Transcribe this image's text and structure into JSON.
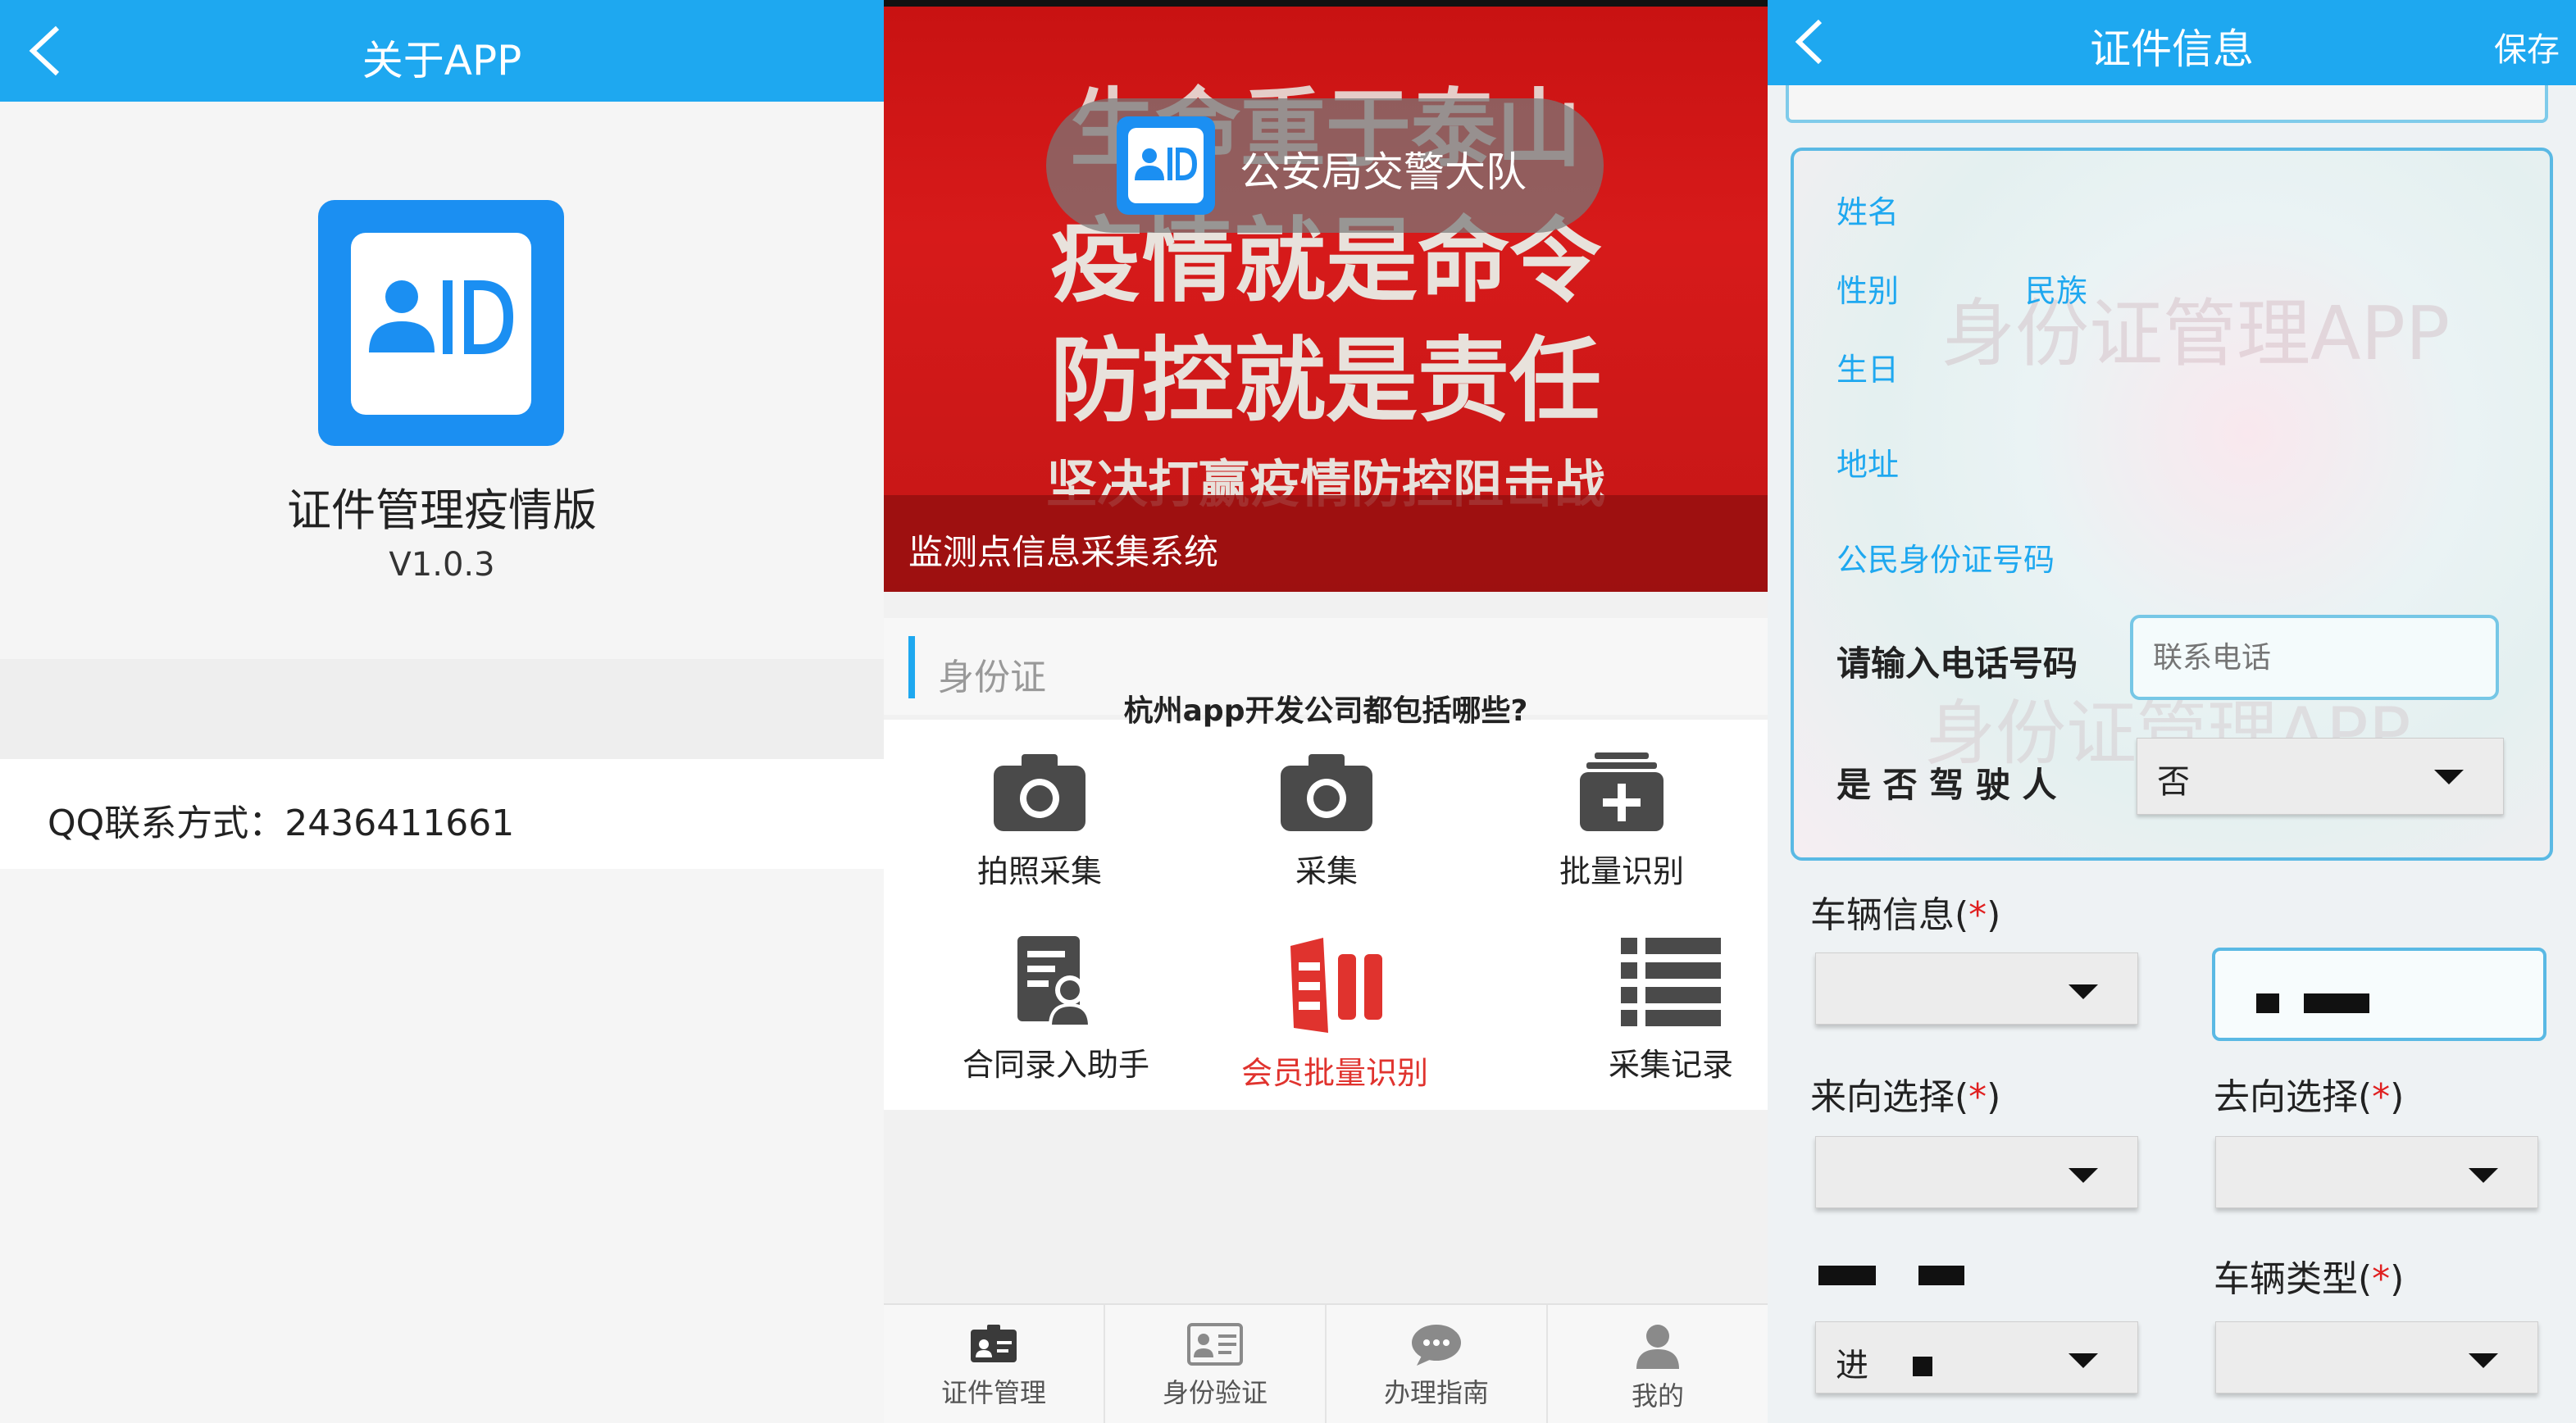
{
  "about_panel": {
    "title": "关于APP",
    "app_name": "证件管理疫情版",
    "version": "V1.0.3",
    "qq_contact": "QQ联系方式：2436411661"
  },
  "home_panel": {
    "banner_slogans": [
      "生命重于泰山",
      "疫情就是命令",
      "防控就是责任",
      "坚决打赢疫情防控阻击战"
    ],
    "org_name": "公安局交警大队",
    "banner_caption": "监测点信息采集系统",
    "section_label": "身份证",
    "overlay_question": "杭州app开发公司都包括哪些?",
    "grid": [
      {
        "label": "拍照采集",
        "icon": "camera-icon"
      },
      {
        "label": "采集",
        "icon": "camera-icon"
      },
      {
        "label": "批量识别",
        "icon": "batch-add-icon"
      },
      {
        "label": "合同录入助手",
        "icon": "contract-user-icon"
      },
      {
        "label": "会员批量识别",
        "icon": "member-batch-icon",
        "color": "#e0332e"
      },
      {
        "label": "采集记录",
        "icon": "list-icon"
      }
    ],
    "tabs": [
      {
        "label": "证件管理",
        "icon": "id-card-icon"
      },
      {
        "label": "身份验证",
        "icon": "id-verify-icon"
      },
      {
        "label": "办理指南",
        "icon": "chat-bubble-icon"
      },
      {
        "label": "我的",
        "icon": "user-icon"
      }
    ]
  },
  "cert_panel": {
    "title": "证件信息",
    "save_label": "保存",
    "card_watermark": "身份证管理APP",
    "fields": {
      "name": "姓名",
      "gender": "性别",
      "ethnicity": "民族",
      "birth": "生日",
      "address": "地址",
      "id_number": "公民身份证号码"
    },
    "phone_label": "请输入电话号码",
    "phone_placeholder": "联系电话",
    "driver_label": "是 否 驾 驶 人",
    "driver_value": "否",
    "vehicle_info_label": "车辆信息(",
    "from_label": "来向选择(",
    "to_label": "去向选择(",
    "vehicle_type_label": "车辆类型(",
    "required_mark": "*",
    "close_paren": ")",
    "direction_value": "进"
  },
  "colors": {
    "header_blue": "#1ea8f0",
    "app_icon_blue": "#1b8ff2",
    "banner_red": "#c81212",
    "accent_red": "#e0332e"
  }
}
